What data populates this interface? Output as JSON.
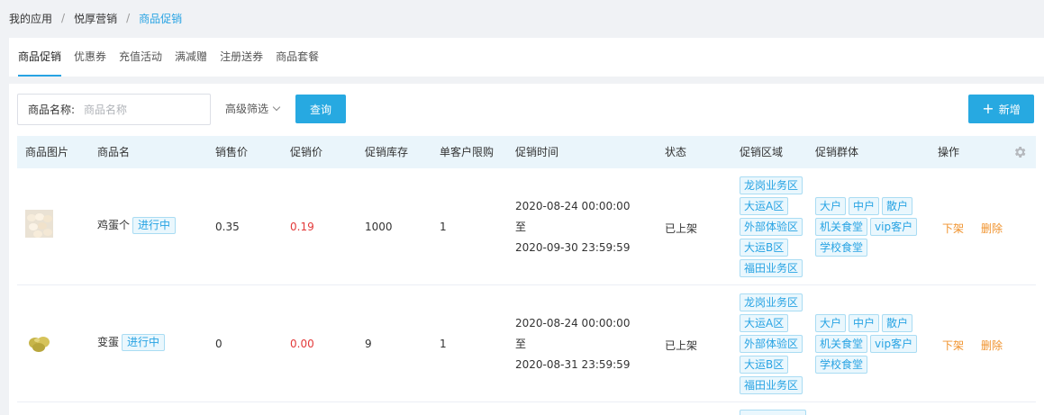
{
  "breadcrumb": [
    "我的应用",
    "悦厚营销",
    "商品促销"
  ],
  "tabs": [
    "商品促销",
    "优惠券",
    "充值活动",
    "满减赠",
    "注册送券",
    "商品套餐"
  ],
  "search": {
    "label": "商品名称:",
    "placeholder": "商品名称",
    "value": ""
  },
  "advanced_filter": "高级筛选",
  "query_button": "查询",
  "add_button": "新增",
  "columns": [
    "商品图片",
    "商品名",
    "销售价",
    "促销价",
    "促销库存",
    "单客户限购",
    "促销时间",
    "状态",
    "促销区域",
    "促销群体",
    "操作"
  ],
  "rows": [
    {
      "name": "鸡蛋个",
      "badge": "进行中",
      "sale_price": "0.35",
      "promo_price": "0.19",
      "stock": "1000",
      "limit": "1",
      "time_start": "2020-08-24 00:00:00",
      "time_sep": "至",
      "time_end": "2020-09-30 23:59:59",
      "status": "已上架",
      "regions": [
        "龙岗业务区",
        "大运A区",
        "外部体验区",
        "大运B区",
        "福田业务区"
      ],
      "groups": [
        "大户",
        "中户",
        "散户",
        "机关食堂",
        "vip客户",
        "学校食堂"
      ],
      "ops": [
        "下架",
        "删除"
      ]
    },
    {
      "name": "变蛋",
      "badge": "进行中",
      "sale_price": "0",
      "promo_price": "0.00",
      "stock": "9",
      "limit": "1",
      "time_start": "2020-08-24 00:00:00",
      "time_sep": "至",
      "time_end": "2020-08-31 23:59:59",
      "status": "已上架",
      "regions": [
        "龙岗业务区",
        "大运A区",
        "外部体验区",
        "大运B区",
        "福田业务区"
      ],
      "groups": [
        "大户",
        "中户",
        "散户",
        "机关食堂",
        "vip客户",
        "学校食堂"
      ],
      "ops": [
        "下架",
        "删除"
      ]
    }
  ],
  "colors": {
    "accent": "#27a9e1",
    "promo_price": "#e33a3a",
    "operation": "#f0922c",
    "header_bg": "#eaf5fb"
  },
  "icons": {
    "settings": "gear-icon",
    "add": "plus-icon",
    "filter": "chevron-down-icon"
  }
}
